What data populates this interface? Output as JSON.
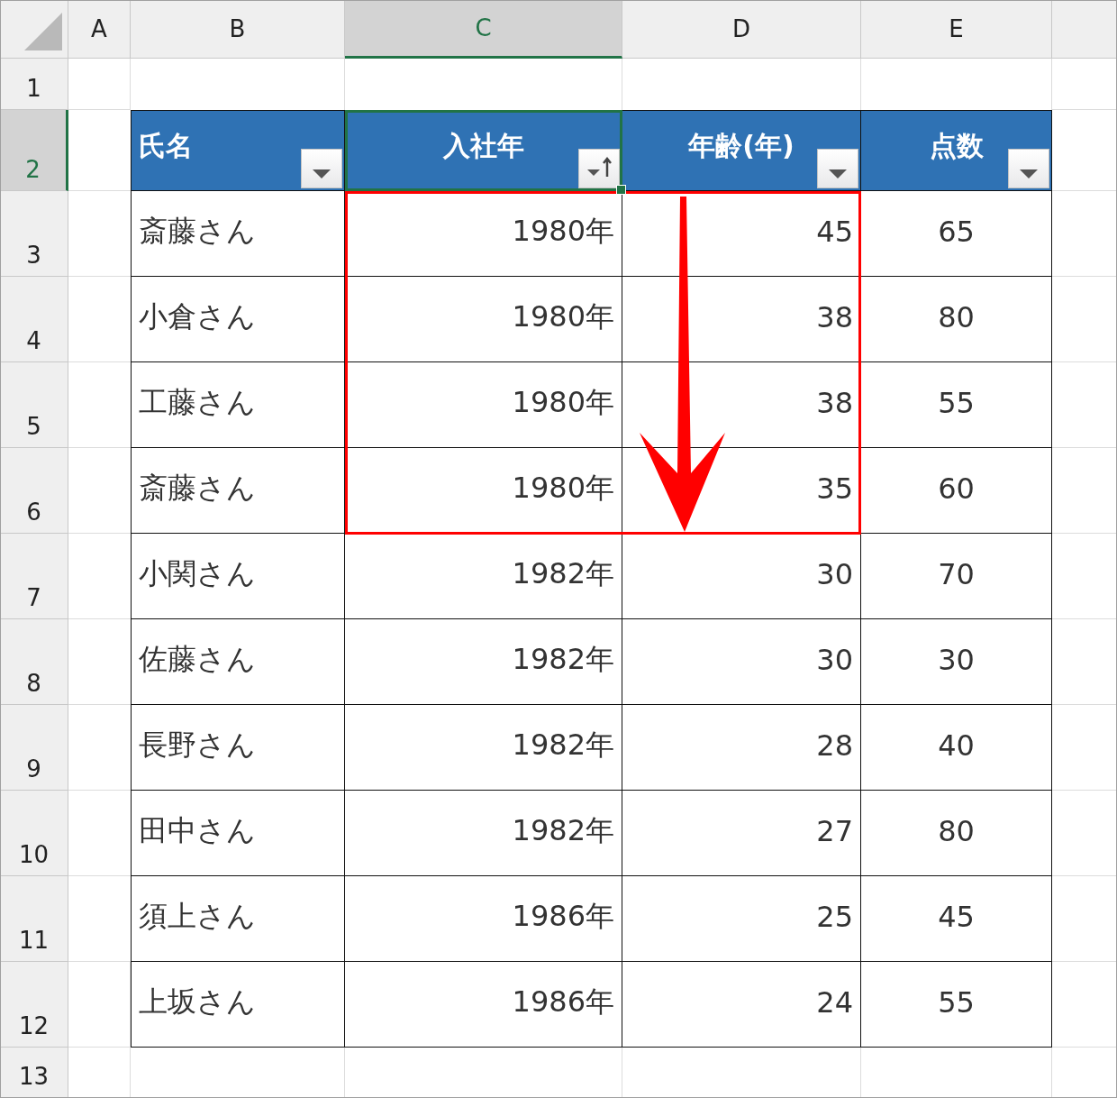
{
  "columns": [
    {
      "label": "A",
      "selected": false
    },
    {
      "label": "B",
      "selected": false
    },
    {
      "label": "C",
      "selected": true
    },
    {
      "label": "D",
      "selected": false
    },
    {
      "label": "E",
      "selected": false
    }
  ],
  "rows": [
    {
      "label": "1",
      "selected": false
    },
    {
      "label": "2",
      "selected": true
    },
    {
      "label": "3",
      "selected": false
    },
    {
      "label": "4",
      "selected": false
    },
    {
      "label": "5",
      "selected": false
    },
    {
      "label": "6",
      "selected": false
    },
    {
      "label": "7",
      "selected": false
    },
    {
      "label": "8",
      "selected": false
    },
    {
      "label": "9",
      "selected": false
    },
    {
      "label": "10",
      "selected": false
    },
    {
      "label": "11",
      "selected": false
    },
    {
      "label": "12",
      "selected": false
    },
    {
      "label": "13",
      "selected": false
    }
  ],
  "table": {
    "headers": [
      {
        "label": "氏名",
        "sorted": false,
        "selected": false
      },
      {
        "label": "入社年",
        "sorted": true,
        "selected": true
      },
      {
        "label": "年齢(年)",
        "sorted": false,
        "selected": false
      },
      {
        "label": "点数",
        "sorted": false,
        "selected": false
      }
    ],
    "records": [
      [
        "斎藤さん",
        "1980年",
        "45",
        "65"
      ],
      [
        "小倉さん",
        "1980年",
        "38",
        "80"
      ],
      [
        "工藤さん",
        "1980年",
        "38",
        "55"
      ],
      [
        "斎藤さん",
        "1980年",
        "35",
        "60"
      ],
      [
        "小関さん",
        "1982年",
        "30",
        "70"
      ],
      [
        "佐藤さん",
        "1982年",
        "30",
        "30"
      ],
      [
        "長野さん",
        "1982年",
        "28",
        "40"
      ],
      [
        "田中さん",
        "1982年",
        "27",
        "80"
      ],
      [
        "須上さん",
        "1986年",
        "25",
        "45"
      ],
      [
        "上坂さん",
        "1986年",
        "24",
        "55"
      ]
    ]
  }
}
